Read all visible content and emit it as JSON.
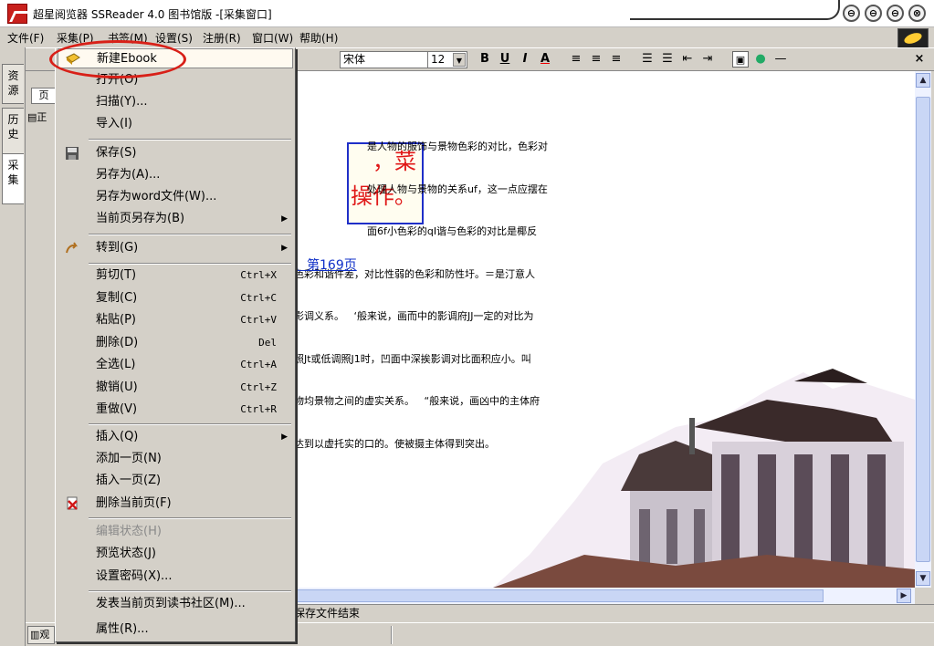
{
  "window": {
    "title": "超星阅览器 SSReader 4.0 图书馆版 -[采集窗口]",
    "buttons": [
      "⊖",
      "⊖",
      "⊖",
      "⊗"
    ]
  },
  "menubar": [
    {
      "label": "文件(F)"
    },
    {
      "label": "采集(P)"
    },
    {
      "label": "书签(M)"
    },
    {
      "label": "设置(S)"
    },
    {
      "label": "注册(R)"
    },
    {
      "label": "窗口(W)"
    },
    {
      "label": "帮助(H)"
    }
  ],
  "toolbar": {
    "font_name": "宋体",
    "font_size": "12",
    "bold": "B",
    "underline": "U",
    "italic": "I",
    "font_color": "A",
    "close": "×"
  },
  "left_tabs": [
    "资源",
    "历史",
    "采集"
  ],
  "panel": {
    "tab_label": "页",
    "row_label": "正"
  },
  "content": {
    "callout_line1": "，菜",
    "callout_line2": "操作。",
    "lines": [
      "是人物的服饰与景物色彩的对比，色彩对",
      "处理人物与景物的关系uf，这一点应摆在",
      "面6f小色彩的qI谐与色彩的对比是椰反",
      "色彩和谐件差，对比性弱的色彩和防性圩。＝是汀意人",
      "影调义系。   ‘般来说，画而中的影调府JJ一定的对比为",
      "照Jt或低调照J1时，凹面中深挨影调对比面积应小。叫",
      "物均景物之间的虚实关系。   “般来说，画凶中的主体府",
      "达到以虚托实的口的。使被摄主体得到突出。"
    ],
    "link": "、第169页"
  },
  "statusbar": {
    "text": "保存文件结束"
  },
  "bottom": {
    "tab_label": "观"
  },
  "context_menu": {
    "items": [
      {
        "label": "新建Ebook",
        "icon": "book-icon",
        "selected": true
      },
      {
        "label": "打开(O)"
      },
      {
        "label": "扫描(Y)..."
      },
      {
        "label": "导入(I)"
      },
      {
        "label": "保存(S)",
        "icon": "save-icon"
      },
      {
        "label": "另存为(A)..."
      },
      {
        "label": "另存为word文件(W)..."
      },
      {
        "label": "当前页另存为(B)",
        "arrow": "▶"
      },
      {
        "label": "转到(G)",
        "icon": "goto-icon",
        "arrow": "▶"
      },
      {
        "label": "剪切(T)",
        "shortcut": "Ctrl+X"
      },
      {
        "label": "复制(C)",
        "shortcut": "Ctrl+C"
      },
      {
        "label": "粘贴(P)",
        "shortcut": "Ctrl+V"
      },
      {
        "label": "删除(D)",
        "shortcut": "Del"
      },
      {
        "label": "全选(L)",
        "shortcut": "Ctrl+A"
      },
      {
        "label": "撤销(U)",
        "shortcut": "Ctrl+Z"
      },
      {
        "label": "重做(V)",
        "shortcut": "Ctrl+R"
      },
      {
        "label": "插入(Q)",
        "arrow": "▶"
      },
      {
        "label": "添加一页(N)"
      },
      {
        "label": "插入一页(Z)"
      },
      {
        "label": "删除当前页(F)",
        "icon": "delete-page-icon"
      },
      {
        "label": "编辑状态(H)",
        "disabled": true
      },
      {
        "label": "预览状态(J)"
      },
      {
        "label": "设置密码(X)..."
      },
      {
        "label": "发表当前页到读书社区(M)..."
      },
      {
        "label": "属性(R)..."
      }
    ]
  }
}
